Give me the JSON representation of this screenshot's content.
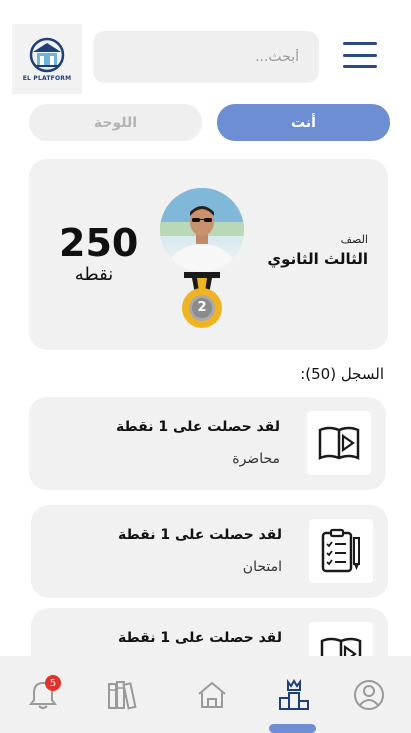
{
  "header": {
    "logo_text": "EL PLATFORM",
    "search_placeholder": "أبحث...",
    "menu_icon": "hamburger-icon"
  },
  "tabs": [
    {
      "label": "أنت",
      "active": true
    },
    {
      "label": "اللوحة",
      "active": false
    }
  ],
  "profile": {
    "points": "250",
    "points_unit": "نقطه",
    "grade_label": "الصف",
    "grade_value": "الثالث الثانوي",
    "medal_rank": "2"
  },
  "log": {
    "title": "السجل (50):"
  },
  "entries": [
    {
      "title": "لقد حصلت على 1 نقطة",
      "type": "محاضرة",
      "icon": "book-play-icon"
    },
    {
      "title": "لقد حصلت على 1 نقطة",
      "type": "امتحان",
      "icon": "clipboard-checklist-icon"
    },
    {
      "title": "لقد حصلت على 1 نقطة",
      "type": "",
      "icon": "book-play-icon"
    }
  ],
  "bottom_nav": {
    "notifications_badge": "5",
    "items": [
      "bell-icon",
      "books-icon",
      "home-icon",
      "ranking-icon",
      "profile-icon"
    ],
    "active": "ranking-icon"
  },
  "colors": {
    "accent": "#6e8ed3",
    "brand_dark": "#2a4a85",
    "card_bg": "#f1f1f1",
    "badge": "#e0332e",
    "medal_gold": "#f0b323"
  }
}
